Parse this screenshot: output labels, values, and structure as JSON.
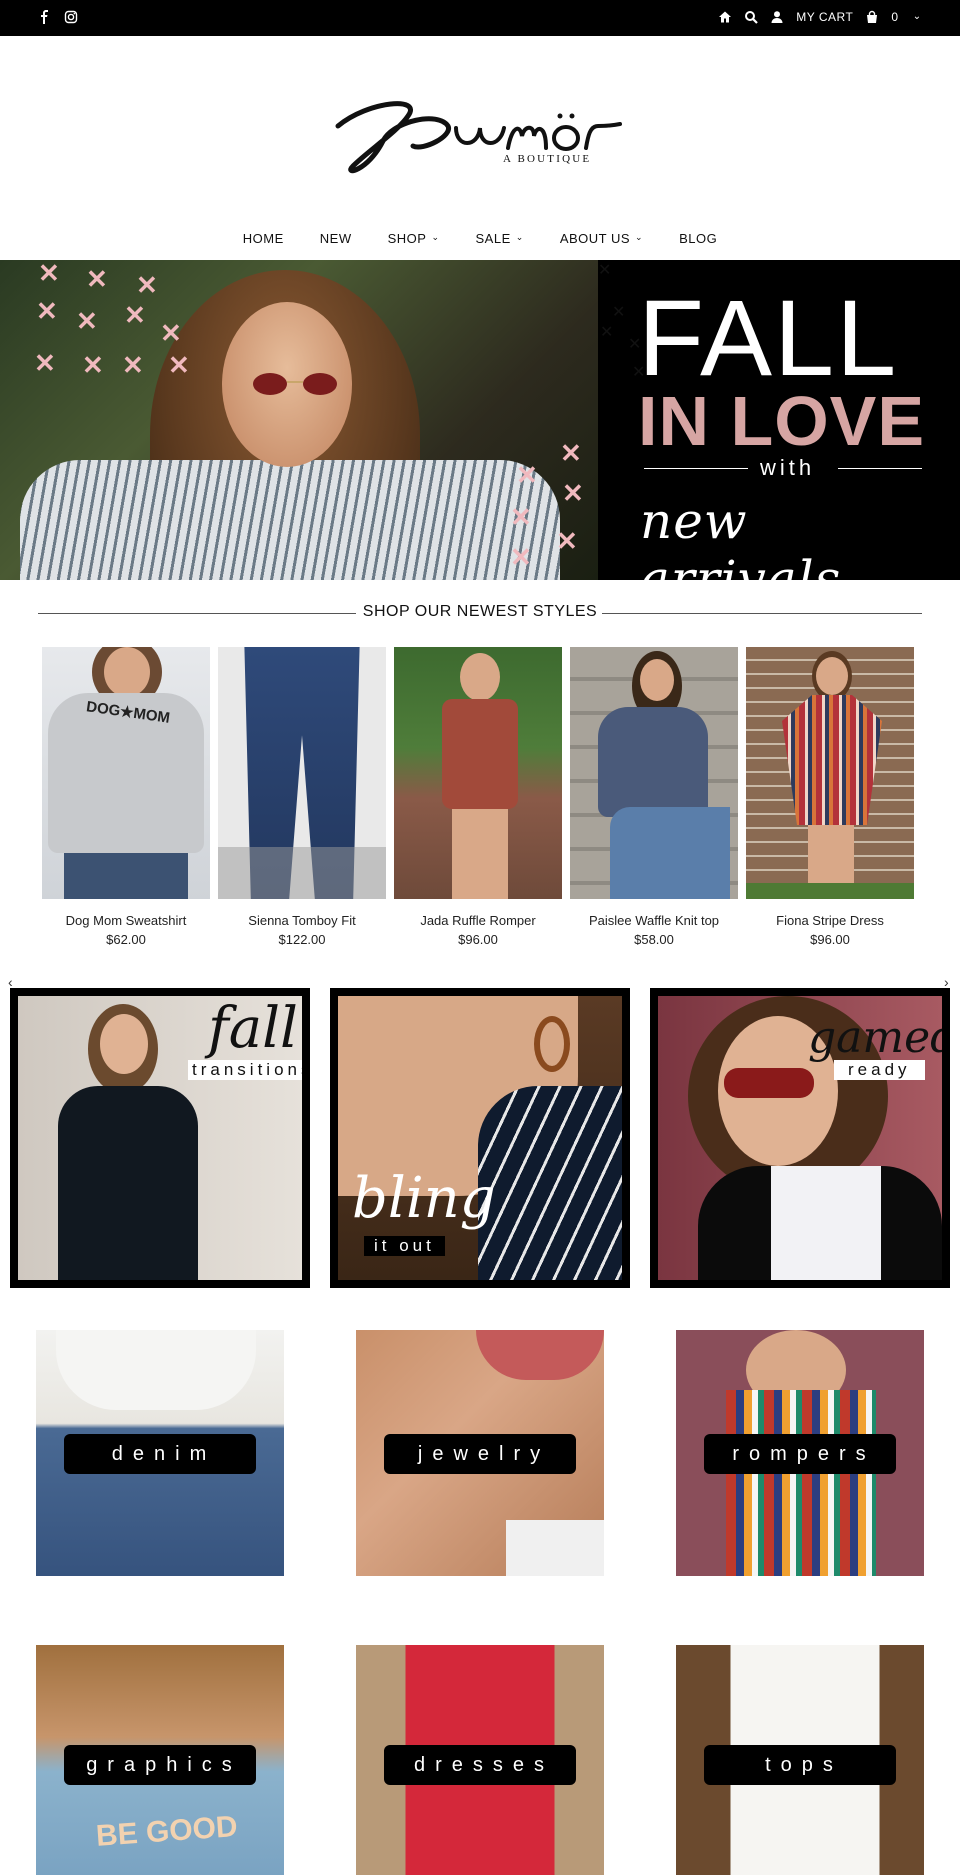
{
  "topbar": {
    "social_icons": [
      "facebook-icon",
      "instagram-icon"
    ],
    "cart_label": "MY CART",
    "cart_count": "0"
  },
  "brand": {
    "logo_script": "Rumör",
    "logo_subtitle": "A BOUTIQUE"
  },
  "nav": {
    "items": [
      {
        "label": "HOME",
        "dropdown": false
      },
      {
        "label": "NEW",
        "dropdown": false
      },
      {
        "label": "SHOP",
        "dropdown": true
      },
      {
        "label": "SALE",
        "dropdown": true
      },
      {
        "label": "ABOUT US",
        "dropdown": true
      },
      {
        "label": "BLOG",
        "dropdown": false
      }
    ]
  },
  "hero": {
    "line1": "FALL",
    "line2": "IN LOVE",
    "line3": "with",
    "line4": "new arrivals",
    "accent_color": "#d6a5a3"
  },
  "newest": {
    "title": "SHOP OUR NEWEST STYLES",
    "products": [
      {
        "name": "Dog Mom Sweatshirt",
        "price": "$62.00",
        "print": "DOG★MOM"
      },
      {
        "name": "Sienna Tomboy Fit",
        "price": "$122.00"
      },
      {
        "name": "Jada Ruffle Romper",
        "price": "$96.00"
      },
      {
        "name": "Paislee Waffle Knit top",
        "price": "$58.00"
      },
      {
        "name": "Fiona Stripe Dress",
        "price": "$96.00"
      }
    ]
  },
  "features": [
    {
      "script": "fall",
      "tag": "transitions"
    },
    {
      "script": "bling",
      "tag": "it out"
    },
    {
      "script": "gameday",
      "tag": "ready"
    }
  ],
  "categories": [
    {
      "label": "denim"
    },
    {
      "label": "jewelry"
    },
    {
      "label": "rompers"
    },
    {
      "label": "graphics"
    },
    {
      "label": "dresses"
    },
    {
      "label": "tops"
    }
  ],
  "graphics_tee_text": "BE GOOD"
}
